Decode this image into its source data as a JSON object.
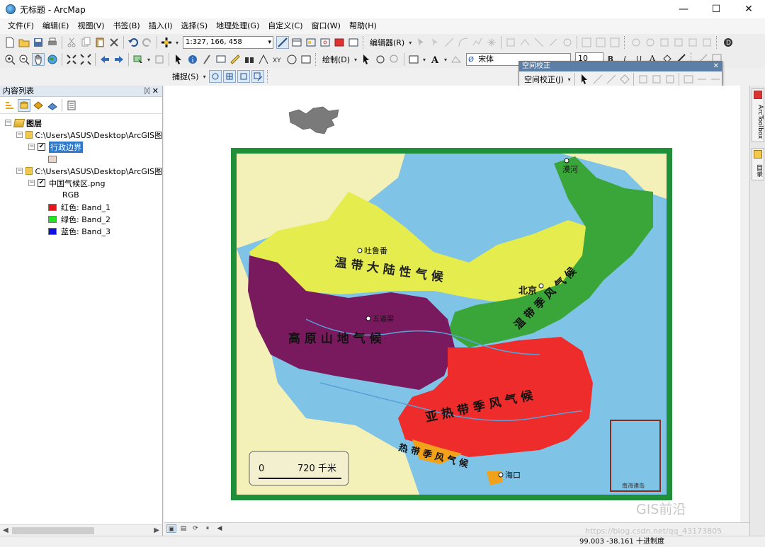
{
  "window": {
    "title": "无标题 - ArcMap",
    "controls": {
      "minimize": "—",
      "maximize": "☐",
      "close": "✕"
    }
  },
  "menu": [
    "文件(F)",
    "编辑(E)",
    "视图(V)",
    "书签(B)",
    "插入(I)",
    "选择(S)",
    "地理处理(G)",
    "自定义(C)",
    "窗口(W)",
    "帮助(H)"
  ],
  "toolbar": {
    "scale": "1:327, 166, 458",
    "editor_label": "编辑器(R)",
    "draw_label": "绘制(D)",
    "font_name": "宋体",
    "font_size": "10",
    "snapping_label": "捕捉(S)"
  },
  "georef": {
    "title": "空间校正",
    "dropdown_label": "空间校正(J)",
    "close": "✕"
  },
  "toc": {
    "title": "内容列表",
    "pin": "ᛞ",
    "close": "✕",
    "root_label": "图层",
    "folder1_path": "C:\\Users\\ASUS\\Desktop\\ArcGIS图",
    "layer1_name": "行政边界",
    "folder2_path": "C:\\Users\\ASUS\\Desktop\\ArcGIS图",
    "layer2_name": "中国气候区.png",
    "rgb_label": "RGB",
    "bands": [
      {
        "label": "红色:   Band_1",
        "color": "#e8141b"
      },
      {
        "label": "绿色: Band_2",
        "color": "#1ee61e"
      },
      {
        "label": "蓝色:   Band_3",
        "color": "#1010e0"
      }
    ],
    "layer1_swatch_color": "#e8d5c8"
  },
  "map": {
    "labels": {
      "temperate_continental": "温 带 大 陆 性 气 候",
      "temperate_monsoon": "温 带 季 风 气 候",
      "plateau": "高 原 山 地 气 候",
      "subtropical": "亚 热 带 季 风 气 候",
      "tropical": "热 带 季 风 气 候",
      "city_tulufan": "吐鲁番",
      "city_beijing": "北京",
      "city_wudaoliang": "五道梁",
      "city_mohe": "漠河",
      "city_haikou": "海口",
      "scale_zero": "0",
      "scale_value": "720 千米",
      "inset_label": "南海诸岛"
    },
    "zone_colors": {
      "continental": "#e4ec4e",
      "monsoon_temperate": "#3aa63a",
      "plateau": "#7a1a5e",
      "subtropical": "#ee2c2c",
      "tropical": "#f2a21a",
      "sea": "#7fc3e6",
      "frame": "#1f8f3a"
    }
  },
  "dock": {
    "arctoolbox": "ArcToolbox",
    "catalog": "目录"
  },
  "status": {
    "coords": "99.003  -38.161 十进制度"
  },
  "watermark": {
    "brand": "GIS前沿",
    "url": "https://blog.csdn.net/qq_43173805"
  }
}
